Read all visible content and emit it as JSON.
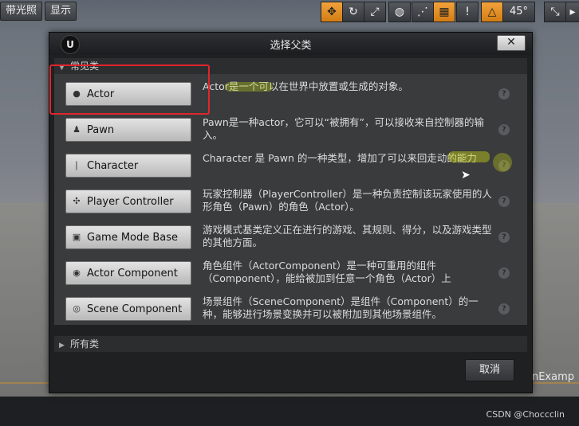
{
  "toolbar": {
    "left_buttons": [
      "带光照",
      "显示"
    ],
    "angle_value": "45°"
  },
  "dialog": {
    "title": "选择父类",
    "common_section": "常见类",
    "all_section": "所有类",
    "cancel": "取消",
    "items": [
      {
        "label": "Actor",
        "icon": "actor-sphere-icon",
        "desc": "Actor是一个可以在世界中放置或生成的对象。"
      },
      {
        "label": "Pawn",
        "icon": "pawn-icon",
        "desc": "Pawn是一种actor，它可以“被拥有”，可以接收来自控制器的输入。"
      },
      {
        "label": "Character",
        "icon": "character-icon",
        "desc": "Character 是 Pawn 的一种类型，增加了可以来回走动的能力"
      },
      {
        "label": "Player Controller",
        "icon": "player-controller-icon",
        "desc": "玩家控制器（PlayerController）是一种负责控制该玩家使用的人形角色（Pawn）的角色（Actor）。"
      },
      {
        "label": "Game Mode Base",
        "icon": "game-mode-icon",
        "desc": "游戏模式基类定义正在进行的游戏、其规则、得分，以及游戏类型的其他方面。"
      },
      {
        "label": "Actor Component",
        "icon": "actor-component-icon",
        "desc": "角色组件（ActorComponent）是一种可重用的组件（Component），能给被加到任意一个角色（Actor）上"
      },
      {
        "label": "Scene Component",
        "icon": "scene-component-icon",
        "desc": "场景组件（SceneComponent）是组件（Component）的一种，能够进行场景变换并可以被附加到其他场景组件。"
      }
    ]
  },
  "background": {
    "corner_text": "onExamp",
    "watermark": "CSDN @Choccclin"
  }
}
